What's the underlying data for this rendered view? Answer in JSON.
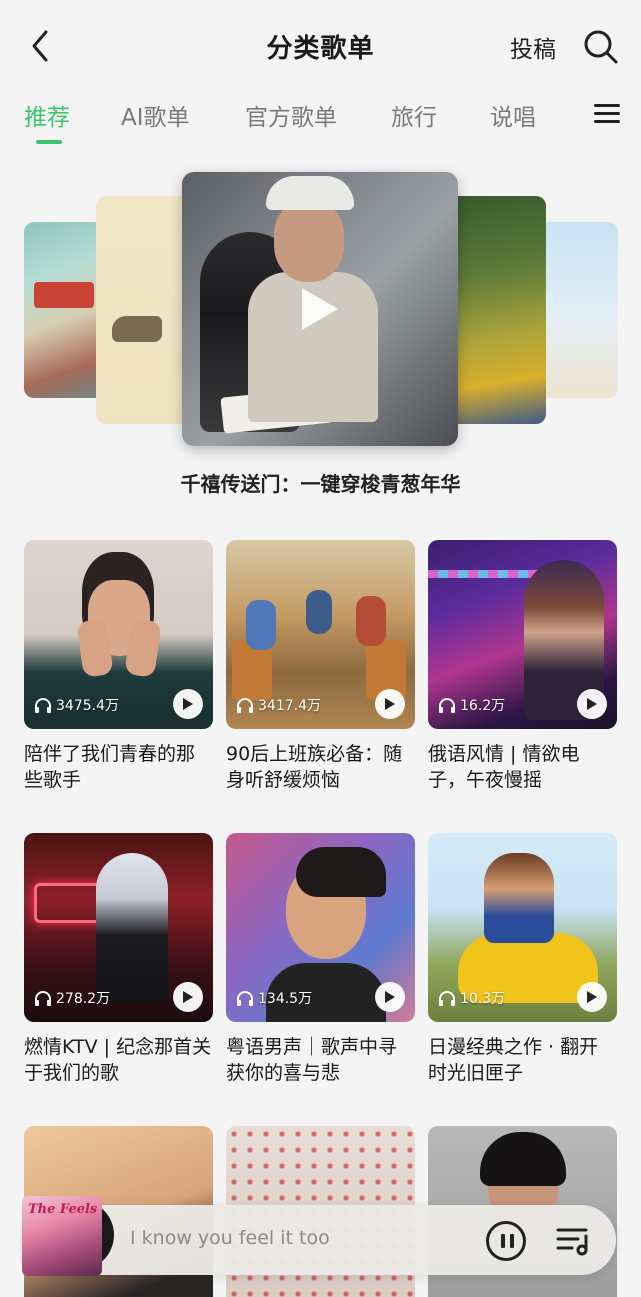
{
  "header": {
    "title": "分类歌单",
    "submit_label": "投稿"
  },
  "tabs": [
    {
      "label": "推荐",
      "active": true
    },
    {
      "label": "AI歌单",
      "active": false
    },
    {
      "label": "官方歌单",
      "active": false
    },
    {
      "label": "旅行",
      "active": false
    },
    {
      "label": "说唱",
      "active": false
    }
  ],
  "carousel": {
    "caption": "千禧传送门：一键穿梭青葱年华"
  },
  "playlists": [
    {
      "count": "3475.4万",
      "title": "陪伴了我们青春的那些歌手"
    },
    {
      "count": "3417.4万",
      "title": "90后上班族必备：随身听舒缓烦恼"
    },
    {
      "count": "16.2万",
      "title": "俄语风情 | 情欲电子，午夜慢摇"
    },
    {
      "count": "278.2万",
      "title": "燃情KTV | 纪念那首关于我们的歌"
    },
    {
      "count": "134.5万",
      "title": "粤语男声｜歌声中寻获你的喜与悲"
    },
    {
      "count": "10.3万",
      "title": "日漫经典之作 · 翻开时光旧匣子"
    }
  ],
  "player": {
    "song": "I know you feel it too",
    "album_text": "The Feels"
  },
  "colors": {
    "accent": "#3ec46d",
    "background": "#f4f4f5"
  }
}
